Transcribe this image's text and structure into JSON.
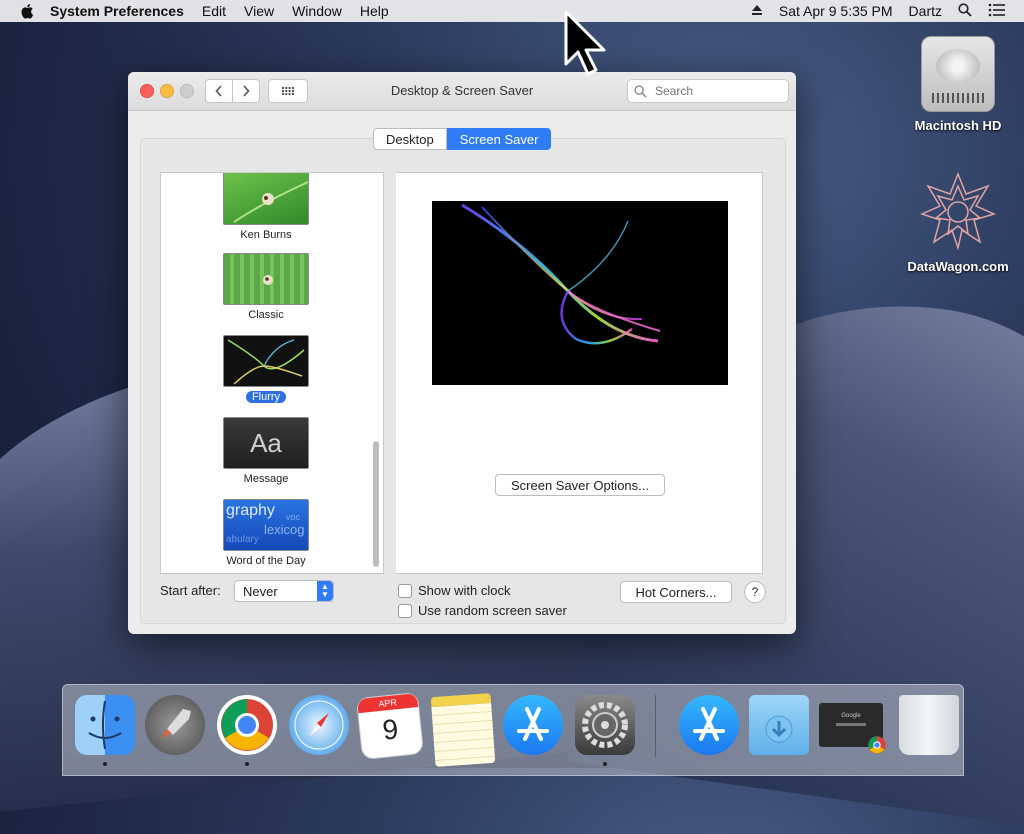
{
  "menubar": {
    "app_name": "System Preferences",
    "menus": [
      "Edit",
      "View",
      "Window",
      "Help"
    ],
    "datetime": "Sat Apr 9  5:35 PM",
    "user": "Dartz"
  },
  "desktop": {
    "icons": [
      {
        "label": "Macintosh HD",
        "icon": "hard-drive-icon"
      },
      {
        "label": "DataWagon.com",
        "icon": "datawagon-icon"
      }
    ]
  },
  "window": {
    "title": "Desktop & Screen Saver",
    "search_placeholder": "Search",
    "tabs": [
      {
        "label": "Desktop",
        "selected": false
      },
      {
        "label": "Screen Saver",
        "selected": true
      }
    ],
    "savers": [
      {
        "label": "Ken Burns",
        "selected": false
      },
      {
        "label": "Classic",
        "selected": false
      },
      {
        "label": "Flurry",
        "selected": true
      },
      {
        "label": "Message",
        "selected": false,
        "thumb_text": "Aa"
      },
      {
        "label": "Word of the Day",
        "selected": false,
        "thumb_words": [
          "graphy",
          "voc",
          "lexicog",
          "abulary"
        ]
      }
    ],
    "options_button": "Screen Saver Options...",
    "start_after_label": "Start after:",
    "start_after_value": "Never",
    "show_with_clock": {
      "label": "Show with clock",
      "checked": false
    },
    "random_saver": {
      "label": "Use random screen saver",
      "checked": false
    },
    "hot_corners_button": "Hot Corners...",
    "help_label": "?"
  },
  "dock": {
    "items": [
      {
        "name": "Finder",
        "running": true
      },
      {
        "name": "Launchpad",
        "running": false
      },
      {
        "name": "Google Chrome",
        "running": true
      },
      {
        "name": "Safari",
        "running": false
      },
      {
        "name": "Calendar",
        "running": false,
        "month": "APR",
        "day": "9"
      },
      {
        "name": "Notes",
        "running": false
      },
      {
        "name": "App Store",
        "running": false
      },
      {
        "name": "System Preferences",
        "running": true
      },
      {
        "name": "App Store Installer",
        "running": false
      },
      {
        "name": "Downloads",
        "running": false
      },
      {
        "name": "Google Chrome Window",
        "running": false,
        "caption": "Google"
      },
      {
        "name": "Trash",
        "running": false
      }
    ]
  },
  "colors": {
    "accent": "#2f7cf6",
    "close": "#fc605c",
    "minimize": "#fdbc40"
  }
}
